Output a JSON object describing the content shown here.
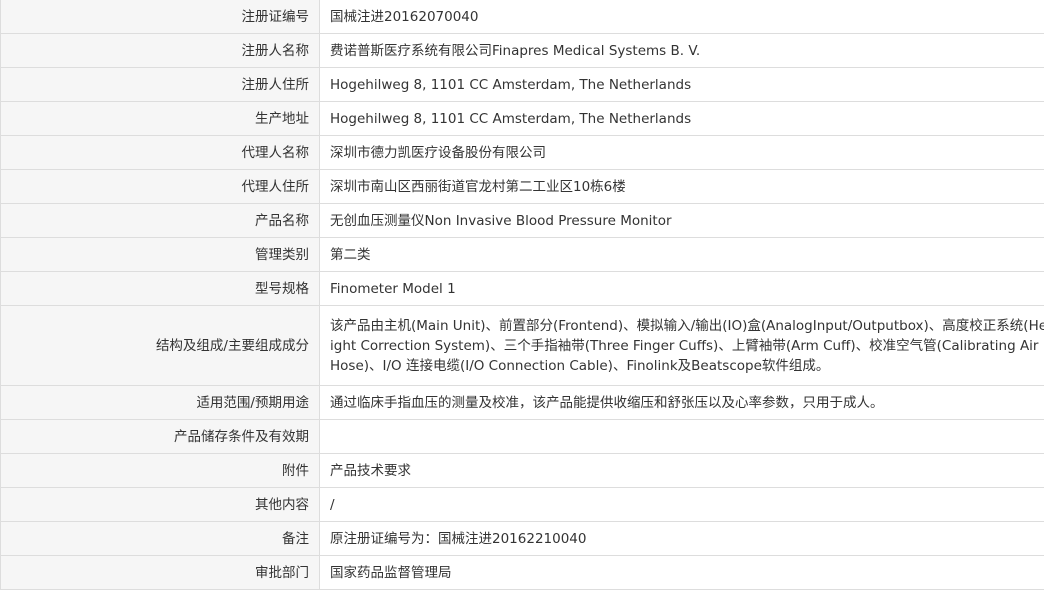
{
  "rows": [
    {
      "key": "registration-number",
      "label": "注册证编号",
      "value": "国械注进20162070040"
    },
    {
      "key": "registrant-name",
      "label": "注册人名称",
      "value": "费诺普斯医疗系统有限公司Finapres Medical Systems B. V."
    },
    {
      "key": "registrant-address",
      "label": "注册人住所",
      "value": "Hogehilweg 8, 1101 CC Amsterdam, The Netherlands"
    },
    {
      "key": "production-address",
      "label": "生产地址",
      "value": "Hogehilweg 8, 1101 CC Amsterdam, The Netherlands"
    },
    {
      "key": "agent-name",
      "label": "代理人名称",
      "value": "深圳市德力凯医疗设备股份有限公司"
    },
    {
      "key": "agent-address",
      "label": "代理人住所",
      "value": "深圳市南山区西丽街道官龙村第二工业区10栋6楼"
    },
    {
      "key": "product-name",
      "label": "产品名称",
      "value": "无创血压测量仪Non Invasive Blood Pressure Monitor"
    },
    {
      "key": "management-category",
      "label": "管理类别",
      "value": "第二类"
    },
    {
      "key": "model-spec",
      "label": "型号规格",
      "value": "Finometer Model 1"
    },
    {
      "key": "structure",
      "label": "结构及组成/主要组成成分",
      "value": "该产品由主机(Main Unit)、前置部分(Frontend)、模拟输入/输出(IO)盒(AnalogInput/Outputbox)、高度校正系统(Height Correction System)、三个手指袖带(Three Finger Cuffs)、上臂袖带(Arm Cuff)、校准空气管(Calibrating Air Hose)、I/O 连接电缆(I/O Connection Cable)、Finolink及Beatscope软件组成。"
    },
    {
      "key": "intended-use",
      "label": "适用范围/预期用途",
      "value": "通过临床手指血压的测量及校准，该产品能提供收缩压和舒张压以及心率参数，只用于成人。"
    },
    {
      "key": "storage-conditions",
      "label": "产品储存条件及有效期",
      "value": ""
    },
    {
      "key": "attachment",
      "label": "附件",
      "value": "产品技术要求"
    },
    {
      "key": "other-content",
      "label": "其他内容",
      "value": "/"
    },
    {
      "key": "remarks",
      "label": "备注",
      "value": "原注册证编号为：国械注进20162210040"
    },
    {
      "key": "approval-department",
      "label": "审批部门",
      "value": "国家药品监督管理局"
    }
  ]
}
